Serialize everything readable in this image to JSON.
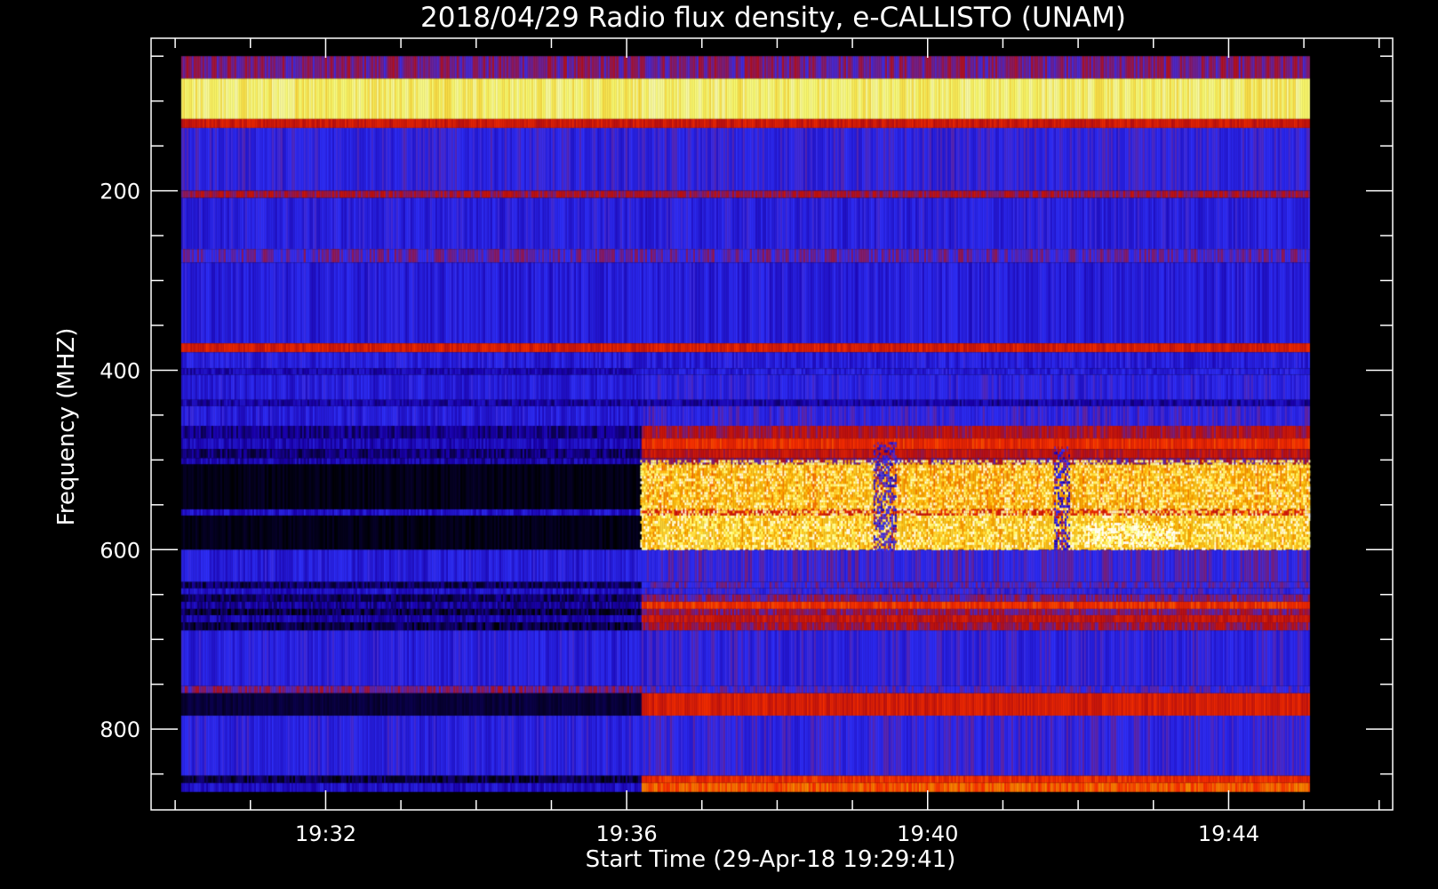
{
  "chart_data": {
    "type": "heatmap",
    "title": "2018/04/29  Radio flux density, e-CALLISTO (UNAM)",
    "xlabel": "Start Time (29-Apr-18 19:29:41)",
    "ylabel": "Frequency (MHZ)",
    "x_unit": "minutes after 19:29:41 UT",
    "x_data_range": [
      0.4,
      15.4
    ],
    "xlim": [
      0,
      16.5
    ],
    "ylim": [
      30,
      890
    ],
    "y_data_range": [
      50,
      870
    ],
    "x_ticks": [
      {
        "value": 2.32,
        "label": "19:32"
      },
      {
        "value": 6.32,
        "label": "19:36"
      },
      {
        "value": 10.32,
        "label": "19:40"
      },
      {
        "value": 14.32,
        "label": "19:44"
      }
    ],
    "y_ticks": [
      {
        "value": 200,
        "label": "200"
      },
      {
        "value": 400,
        "label": "400"
      },
      {
        "value": 600,
        "label": "600"
      },
      {
        "value": 800,
        "label": "800"
      }
    ],
    "colormap": [
      "#000000",
      "#1a00b0",
      "#3030ff",
      "#c01010",
      "#ff3000",
      "#ffb000",
      "#ffff70",
      "#ffffff"
    ],
    "grid": false,
    "receiver_change_time": 6.5,
    "bands": [
      {
        "f0": 50,
        "f1": 75,
        "level_before": 0.36,
        "level_after": 0.36
      },
      {
        "f0": 75,
        "f1": 120,
        "level_before": 0.86,
        "level_after": 0.86
      },
      {
        "f0": 120,
        "f1": 130,
        "level_before": 0.48,
        "level_after": 0.48
      },
      {
        "f0": 130,
        "f1": 200,
        "level_before": 0.27,
        "level_after": 0.27
      },
      {
        "f0": 200,
        "f1": 208,
        "level_before": 0.4,
        "level_after": 0.4
      },
      {
        "f0": 208,
        "f1": 265,
        "level_before": 0.25,
        "level_after": 0.25
      },
      {
        "f0": 265,
        "f1": 280,
        "level_before": 0.33,
        "level_after": 0.33
      },
      {
        "f0": 280,
        "f1": 370,
        "level_before": 0.24,
        "level_after": 0.24
      },
      {
        "f0": 370,
        "f1": 380,
        "level_before": 0.5,
        "level_after": 0.5
      },
      {
        "f0": 380,
        "f1": 398,
        "level_before": 0.24,
        "level_after": 0.24
      },
      {
        "f0": 398,
        "f1": 405,
        "level_before": 0.17,
        "level_after": 0.24
      },
      {
        "f0": 405,
        "f1": 433,
        "level_before": 0.24,
        "level_after": 0.26
      },
      {
        "f0": 433,
        "f1": 440,
        "level_before": 0.15,
        "level_after": 0.15
      },
      {
        "f0": 440,
        "f1": 462,
        "level_before": 0.24,
        "level_after": 0.28
      },
      {
        "f0": 462,
        "f1": 476,
        "level_before": 0.12,
        "level_after": 0.42
      },
      {
        "f0": 476,
        "f1": 488,
        "level_before": 0.18,
        "level_after": 0.55
      },
      {
        "f0": 488,
        "f1": 498,
        "level_before": 0.1,
        "level_after": 0.45
      },
      {
        "f0": 498,
        "f1": 505,
        "level_before": 0.16,
        "level_after": 0.38
      },
      {
        "f0": 505,
        "f1": 555,
        "level_before": 0.02,
        "level_after": 0.7
      },
      {
        "f0": 555,
        "f1": 562,
        "level_before": 0.2,
        "level_after": 0.5
      },
      {
        "f0": 562,
        "f1": 600,
        "level_before": 0.02,
        "level_after": 0.74
      },
      {
        "f0": 600,
        "f1": 636,
        "level_before": 0.24,
        "level_after": 0.3
      },
      {
        "f0": 636,
        "f1": 643,
        "level_before": 0.08,
        "level_after": 0.32
      },
      {
        "f0": 643,
        "f1": 650,
        "level_before": 0.2,
        "level_after": 0.28
      },
      {
        "f0": 650,
        "f1": 658,
        "level_before": 0.08,
        "level_after": 0.36
      },
      {
        "f0": 658,
        "f1": 666,
        "level_before": 0.14,
        "level_after": 0.56
      },
      {
        "f0": 666,
        "f1": 673,
        "level_before": 0.06,
        "level_after": 0.38
      },
      {
        "f0": 673,
        "f1": 681,
        "level_before": 0.16,
        "level_after": 0.46
      },
      {
        "f0": 681,
        "f1": 690,
        "level_before": 0.06,
        "level_after": 0.4
      },
      {
        "f0": 690,
        "f1": 752,
        "level_before": 0.25,
        "level_after": 0.27
      },
      {
        "f0": 752,
        "f1": 760,
        "level_before": 0.36,
        "level_after": 0.3
      },
      {
        "f0": 760,
        "f1": 785,
        "level_before": 0.05,
        "level_after": 0.5
      },
      {
        "f0": 785,
        "f1": 852,
        "level_before": 0.26,
        "level_after": 0.28
      },
      {
        "f0": 852,
        "f1": 860,
        "level_before": 0.06,
        "level_after": 0.55
      },
      {
        "f0": 860,
        "f1": 870,
        "level_before": 0.2,
        "level_after": 0.62
      }
    ],
    "bursts": [
      {
        "t0": 6.5,
        "t1": 15.4,
        "f0": 500,
        "f1": 560,
        "level": 0.86
      },
      {
        "t0": 6.5,
        "t1": 15.4,
        "f0": 562,
        "f1": 600,
        "level": 0.88
      },
      {
        "t0": 12.4,
        "t1": 13.6,
        "f0": 570,
        "f1": 595,
        "level": 0.98
      },
      {
        "t0": 9.6,
        "t1": 9.9,
        "f0": 480,
        "f1": 600,
        "level": 0.3
      },
      {
        "t0": 12.0,
        "t1": 12.2,
        "f0": 485,
        "f1": 600,
        "level": 0.3
      }
    ]
  }
}
